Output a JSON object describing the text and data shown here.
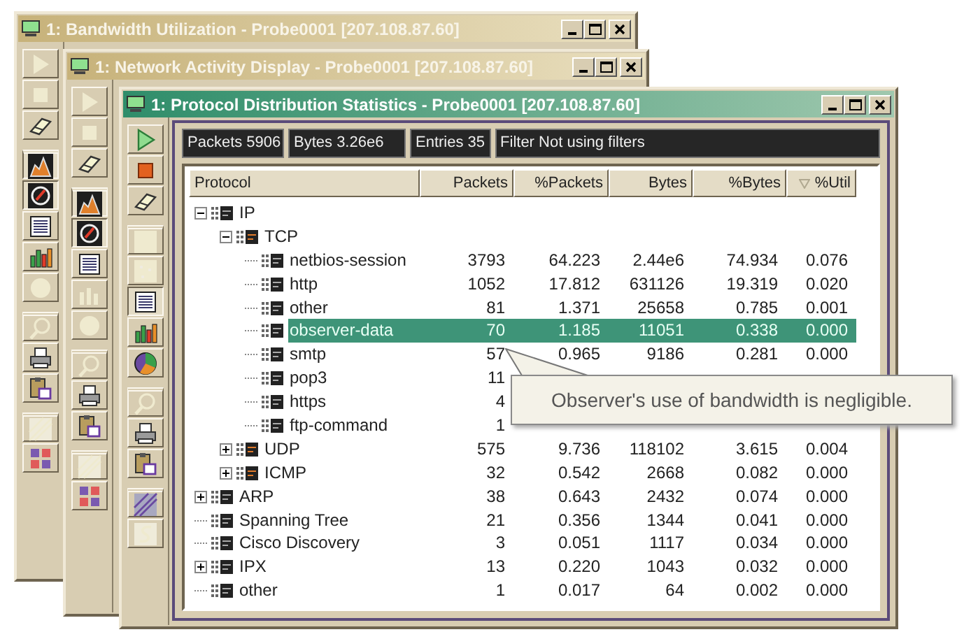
{
  "windows": [
    {
      "title": "1: Bandwidth Utilization - Probe0001 [207.108.87.60]",
      "active": false,
      "toolbar": [
        {
          "kind": "play",
          "pressed": false,
          "disabled": true,
          "group_start": false
        },
        {
          "kind": "stop",
          "pressed": false,
          "disabled": true,
          "group_start": false
        },
        {
          "kind": "eraser",
          "pressed": false,
          "disabled": false,
          "group_start": false
        },
        {
          "kind": "area",
          "pressed": true,
          "disabled": false,
          "group_start": true
        },
        {
          "kind": "dial",
          "pressed": true,
          "disabled": false,
          "group_start": false
        },
        {
          "kind": "list",
          "pressed": false,
          "disabled": false,
          "group_start": false
        },
        {
          "kind": "bars",
          "pressed": false,
          "disabled": false,
          "group_start": false
        },
        {
          "kind": "circle",
          "pressed": false,
          "disabled": true,
          "group_start": false
        },
        {
          "kind": "magnifier",
          "pressed": false,
          "disabled": true,
          "group_start": true
        },
        {
          "kind": "printer",
          "pressed": false,
          "disabled": false,
          "group_start": false
        },
        {
          "kind": "clipboard",
          "pressed": false,
          "disabled": false,
          "group_start": false
        },
        {
          "kind": "setup",
          "pressed": false,
          "disabled": true,
          "group_start": true
        },
        {
          "kind": "grid",
          "pressed": false,
          "disabled": false,
          "group_start": false
        }
      ]
    },
    {
      "title": "1: Network Activity Display - Probe0001 [207.108.87.60]",
      "active": false,
      "toolbar": [
        {
          "kind": "play",
          "pressed": false,
          "disabled": true,
          "group_start": false
        },
        {
          "kind": "stop",
          "pressed": false,
          "disabled": true,
          "group_start": false
        },
        {
          "kind": "eraser",
          "pressed": false,
          "disabled": false,
          "group_start": false
        },
        {
          "kind": "area",
          "pressed": true,
          "disabled": false,
          "group_start": true
        },
        {
          "kind": "dial",
          "pressed": true,
          "disabled": false,
          "group_start": false
        },
        {
          "kind": "list",
          "pressed": false,
          "disabled": false,
          "group_start": false
        },
        {
          "kind": "bars",
          "pressed": false,
          "disabled": true,
          "group_start": false
        },
        {
          "kind": "circle",
          "pressed": false,
          "disabled": true,
          "group_start": false
        },
        {
          "kind": "magnifier",
          "pressed": false,
          "disabled": true,
          "group_start": true
        },
        {
          "kind": "printer",
          "pressed": false,
          "disabled": false,
          "group_start": false
        },
        {
          "kind": "clipboard",
          "pressed": false,
          "disabled": false,
          "group_start": false
        },
        {
          "kind": "setup",
          "pressed": false,
          "disabled": true,
          "group_start": true
        },
        {
          "kind": "grid",
          "pressed": false,
          "disabled": false,
          "group_start": false
        }
      ]
    },
    {
      "title": "1: Protocol Distribution Statistics - Probe0001 [207.108.87.60]",
      "active": true,
      "toolbar": [
        {
          "kind": "play",
          "pressed": false,
          "disabled": false,
          "group_start": false
        },
        {
          "kind": "stop",
          "pressed": false,
          "disabled": false,
          "group_start": false
        },
        {
          "kind": "eraser",
          "pressed": false,
          "disabled": false,
          "group_start": false
        },
        {
          "kind": "square",
          "pressed": false,
          "disabled": true,
          "group_start": true
        },
        {
          "kind": "dots",
          "pressed": false,
          "disabled": true,
          "group_start": false
        },
        {
          "kind": "list",
          "pressed": true,
          "disabled": false,
          "group_start": false
        },
        {
          "kind": "bars",
          "pressed": false,
          "disabled": false,
          "group_start": false
        },
        {
          "kind": "pie",
          "pressed": false,
          "disabled": false,
          "group_start": false
        },
        {
          "kind": "magnifier",
          "pressed": false,
          "disabled": true,
          "group_start": true
        },
        {
          "kind": "printer",
          "pressed": false,
          "disabled": false,
          "group_start": false
        },
        {
          "kind": "clipboard",
          "pressed": false,
          "disabled": false,
          "group_start": false
        },
        {
          "kind": "setup",
          "pressed": false,
          "disabled": false,
          "group_start": true
        },
        {
          "kind": "swirl",
          "pressed": false,
          "disabled": true,
          "group_start": false
        }
      ],
      "stats": [
        "Packets 5906",
        "Bytes 3.26e6",
        "Entries 35",
        "Filter Not using filters"
      ],
      "table": {
        "columns": [
          {
            "label": "Protocol",
            "sorted": false
          },
          {
            "label": "Packets",
            "sorted": false
          },
          {
            "label": "%Packets",
            "sorted": false
          },
          {
            "label": "Bytes",
            "sorted": false
          },
          {
            "label": "%Bytes",
            "sorted": false
          },
          {
            "label": "%Util",
            "sorted": true
          }
        ],
        "rows": [
          {
            "kind": "group",
            "expanded": true,
            "name": "IP",
            "selected": false,
            "children": [
              {
                "kind": "group",
                "expanded": true,
                "name": "TCP",
                "selected": false,
                "children": [
                  {
                    "kind": "leaf",
                    "name": "netbios-session",
                    "selected": false,
                    "values": [
                      "3793",
                      "64.223",
                      "2.44e6",
                      "74.934",
                      "0.076"
                    ]
                  },
                  {
                    "kind": "leaf",
                    "name": "http",
                    "selected": false,
                    "values": [
                      "1052",
                      "17.812",
                      "631126",
                      "19.319",
                      "0.020"
                    ]
                  },
                  {
                    "kind": "leaf",
                    "name": "other",
                    "selected": false,
                    "values": [
                      "81",
                      "1.371",
                      "25658",
                      "0.785",
                      "0.001"
                    ]
                  },
                  {
                    "kind": "leaf",
                    "name": "observer-data",
                    "selected": true,
                    "values": [
                      "70",
                      "1.185",
                      "11051",
                      "0.338",
                      "0.000"
                    ]
                  },
                  {
                    "kind": "leaf",
                    "name": "smtp",
                    "selected": false,
                    "values": [
                      "57",
                      "0.965",
                      "9186",
                      "0.281",
                      "0.000"
                    ]
                  },
                  {
                    "kind": "leaf",
                    "name": "pop3",
                    "selected": false,
                    "values": [
                      "11"
                    ]
                  },
                  {
                    "kind": "leaf",
                    "name": "https",
                    "selected": false,
                    "values": [
                      "4"
                    ]
                  },
                  {
                    "kind": "leaf",
                    "name": "ftp-command",
                    "selected": false,
                    "values": [
                      "1"
                    ]
                  }
                ]
              },
              {
                "kind": "group",
                "expanded": false,
                "name": "UDP",
                "selected": false,
                "values": [
                  "575",
                  "9.736",
                  "118102",
                  "3.615",
                  "0.004"
                ]
              },
              {
                "kind": "group",
                "expanded": false,
                "name": "ICMP",
                "selected": false,
                "values": [
                  "32",
                  "0.542",
                  "2668",
                  "0.082",
                  "0.000"
                ]
              }
            ]
          },
          {
            "kind": "group",
            "expanded": false,
            "name": "ARP",
            "selected": false,
            "values": [
              "38",
              "0.643",
              "2432",
              "0.074",
              "0.000"
            ]
          },
          {
            "kind": "leaf",
            "name": "Spanning Tree",
            "selected": false,
            "values": [
              "21",
              "0.356",
              "1344",
              "0.041",
              "0.000"
            ]
          },
          {
            "kind": "leaf",
            "name": "Cisco Discovery",
            "selected": false,
            "values": [
              "3",
              "0.051",
              "1117",
              "0.034",
              "0.000"
            ]
          },
          {
            "kind": "group",
            "expanded": false,
            "name": "IPX",
            "selected": false,
            "values": [
              "13",
              "0.220",
              "1043",
              "0.032",
              "0.000"
            ]
          },
          {
            "kind": "leaf",
            "name": "other",
            "selected": false,
            "values": [
              "1",
              "0.017",
              "64",
              "0.002",
              "0.000"
            ]
          }
        ]
      }
    }
  ],
  "callout": {
    "text": "Observer's use of bandwidth is negligible."
  }
}
